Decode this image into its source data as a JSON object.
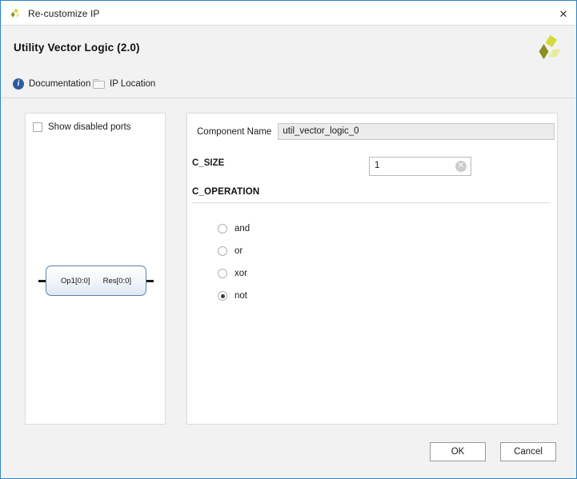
{
  "window": {
    "title": "Re-customize IP",
    "app_icon": "xilinx-logo-icon",
    "close_icon": "✕"
  },
  "header": {
    "title": "Utility Vector Logic (2.0)",
    "brand_icon": "xilinx-pinwheel-logo"
  },
  "links": {
    "documentation": {
      "label": "Documentation",
      "icon": "info-icon",
      "icon_glyph": "i"
    },
    "ip_location": {
      "label": "IP Location",
      "icon": "folder-icon"
    }
  },
  "left_panel": {
    "show_disabled_ports": {
      "label": "Show disabled ports",
      "checked": false
    },
    "symbol": {
      "input_port": "Op1[0:0]",
      "output_port": "Res[0:0]"
    }
  },
  "right_panel": {
    "component_name": {
      "label": "Component Name",
      "value": "util_vector_logic_0"
    },
    "c_size": {
      "label": "C_SIZE",
      "value": "1",
      "clear_icon": "✕"
    },
    "c_operation": {
      "title": "C_OPERATION",
      "options": [
        {
          "label": "and",
          "selected": false
        },
        {
          "label": "or",
          "selected": false
        },
        {
          "label": "xor",
          "selected": false
        },
        {
          "label": "not",
          "selected": true
        }
      ]
    }
  },
  "footer": {
    "ok_label": "OK",
    "cancel_label": "Cancel"
  },
  "colors": {
    "accent_border": "#2e86c9",
    "dialog_background": "#f2f2f2",
    "brand_olive": "#9aa021",
    "brand_yellow": "#d4da3c",
    "brand_pale": "#e8ec9a",
    "info_blue": "#2e5d9e",
    "symbol_border": "#5b7fa8"
  }
}
